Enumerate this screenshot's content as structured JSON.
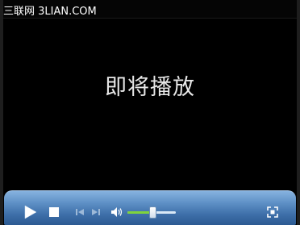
{
  "watermark": {
    "text": "三联网 3LIAN.COM"
  },
  "video": {
    "status_text": "即将播放"
  },
  "controls": {
    "volume_level": 0.5
  },
  "icons": {
    "play": "play-icon",
    "stop": "stop-icon",
    "previous": "previous-track-icon",
    "next": "next-track-icon",
    "volume": "speaker-icon",
    "fullscreen": "fullscreen-icon"
  },
  "colors": {
    "bar_top": "#86b2df",
    "bar_bottom": "#2c5a92",
    "volume_fill": "#7fd43b",
    "status_text": "#e8e8e8"
  }
}
